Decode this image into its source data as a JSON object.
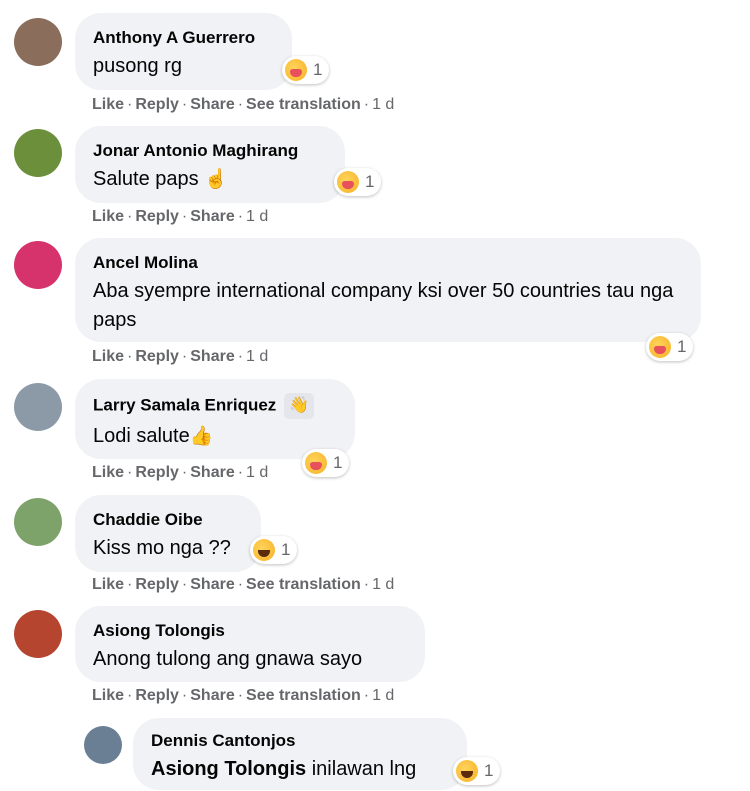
{
  "comments": [
    {
      "name": "Anthony A Guerrero",
      "text": "pusong rg",
      "react_count": "1",
      "actions": [
        "Like",
        "Reply",
        "Share",
        "See translation"
      ],
      "time": "1 d",
      "avatar_color": "#8a6d5a"
    },
    {
      "name": "Jonar Antonio Maghirang",
      "text": "Salute paps",
      "emoji": "☝",
      "react_count": "1",
      "actions": [
        "Like",
        "Reply",
        "Share"
      ],
      "time": "1 d",
      "avatar_color": "#6b8f3a"
    },
    {
      "name": "Ancel Molina",
      "text": "Aba syempre international company ksi over 50 countries tau nga paps",
      "react_count": "1",
      "actions": [
        "Like",
        "Reply",
        "Share"
      ],
      "time": "1 d",
      "avatar_color": "#d6336c"
    },
    {
      "name": "Larry Samala Enriquez",
      "badge": "👋",
      "text": "Lodi salute",
      "emoji": "👍",
      "react_count": "1",
      "actions": [
        "Like",
        "Reply",
        "Share"
      ],
      "time": "1 d",
      "avatar_color": "#8c9aa8"
    },
    {
      "name": "Chaddie Oibe",
      "text": "Kiss mo nga ??",
      "react_count": "1",
      "actions": [
        "Like",
        "Reply",
        "Share",
        "See translation"
      ],
      "time": "1 d",
      "avatar_color": "#7da36a"
    },
    {
      "name": "Asiong Tolongis",
      "text": "Anong tulong ang gnawa sayo",
      "actions": [
        "Like",
        "Reply",
        "Share",
        "See translation"
      ],
      "time": "1 d",
      "avatar_color": "#b5452f"
    }
  ],
  "reply": {
    "name": "Dennis Cantonjos",
    "mention": "Asiong Tolongis",
    "text": "inilawan lng",
    "react_count": "1",
    "avatar_color": "#6a7f94"
  }
}
